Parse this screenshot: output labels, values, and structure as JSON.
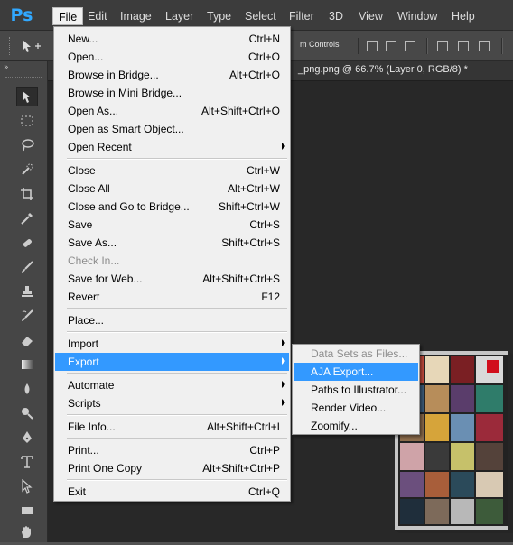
{
  "app": {
    "logo_text": "Ps"
  },
  "menubar": {
    "items": [
      {
        "label": "File",
        "active": true
      },
      {
        "label": "Edit"
      },
      {
        "label": "Image"
      },
      {
        "label": "Layer"
      },
      {
        "label": "Type"
      },
      {
        "label": "Select"
      },
      {
        "label": "Filter"
      },
      {
        "label": "3D"
      },
      {
        "label": "View"
      },
      {
        "label": "Window"
      },
      {
        "label": "Help"
      }
    ]
  },
  "options_bar": {
    "transform_controls_label": "m Controls"
  },
  "document_tab": {
    "title": "_png.png @ 66.7% (Layer 0, RGB/8) *",
    "close_glyph": "×"
  },
  "file_menu": {
    "items": [
      {
        "label": "New...",
        "shortcut": "Ctrl+N"
      },
      {
        "label": "Open...",
        "shortcut": "Ctrl+O"
      },
      {
        "label": "Browse in Bridge...",
        "shortcut": "Alt+Ctrl+O"
      },
      {
        "label": "Browse in Mini Bridge...",
        "shortcut": ""
      },
      {
        "label": "Open As...",
        "shortcut": "Alt+Shift+Ctrl+O"
      },
      {
        "label": "Open as Smart Object...",
        "shortcut": ""
      },
      {
        "label": "Open Recent",
        "shortcut": "",
        "submenu": true
      },
      {
        "label": "Close",
        "shortcut": "Ctrl+W"
      },
      {
        "label": "Close All",
        "shortcut": "Alt+Ctrl+W"
      },
      {
        "label": "Close and Go to Bridge...",
        "shortcut": "Shift+Ctrl+W"
      },
      {
        "label": "Save",
        "shortcut": "Ctrl+S"
      },
      {
        "label": "Save As...",
        "shortcut": "Shift+Ctrl+S"
      },
      {
        "label": "Check In...",
        "shortcut": "",
        "disabled": true
      },
      {
        "label": "Save for Web...",
        "shortcut": "Alt+Shift+Ctrl+S"
      },
      {
        "label": "Revert",
        "shortcut": "F12"
      },
      {
        "label": "Place...",
        "shortcut": ""
      },
      {
        "label": "Import",
        "shortcut": "",
        "submenu": true
      },
      {
        "label": "Export",
        "shortcut": "",
        "submenu": true,
        "highlighted": true
      },
      {
        "label": "Automate",
        "shortcut": "",
        "submenu": true
      },
      {
        "label": "Scripts",
        "shortcut": "",
        "submenu": true
      },
      {
        "label": "File Info...",
        "shortcut": "Alt+Shift+Ctrl+I"
      },
      {
        "label": "Print...",
        "shortcut": "Ctrl+P"
      },
      {
        "label": "Print One Copy",
        "shortcut": "Alt+Shift+Ctrl+P"
      },
      {
        "label": "Exit",
        "shortcut": "Ctrl+Q"
      }
    ]
  },
  "export_submenu": {
    "items": [
      {
        "label": "Data Sets as Files...",
        "disabled": true
      },
      {
        "label": "AJA Export...",
        "highlighted": true
      },
      {
        "label": "Paths to Illustrator..."
      },
      {
        "label": "Render Video..."
      },
      {
        "label": "Zoomify..."
      }
    ]
  },
  "colors": {
    "menu_highlight": "#3399ff",
    "menu_bg": "#f0f0f0",
    "ps_blue": "#31a8ff",
    "workspace": "#282828"
  }
}
